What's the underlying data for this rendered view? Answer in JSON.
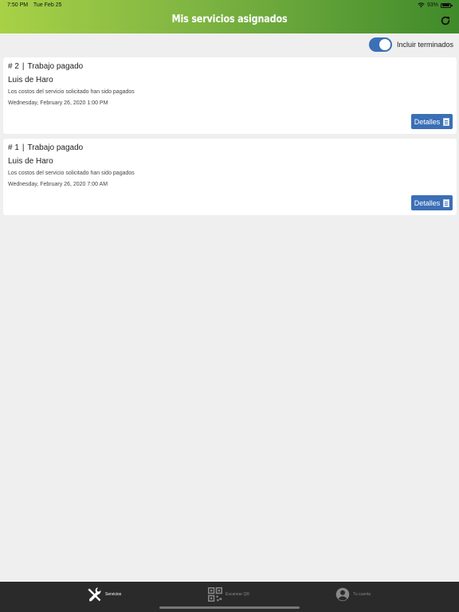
{
  "status_bar": {
    "time": "7:50 PM",
    "date": "Tue Feb 25",
    "battery": "93%",
    "battery_level": 0.93
  },
  "header": {
    "title": "Mis servicios asignados",
    "refresh_icon": "refresh-icon",
    "gradient_colors": [
      "#a8d146",
      "#3f8a2a"
    ]
  },
  "filter": {
    "label": "Incluir terminados",
    "enabled": true,
    "accent": "#3b6fb6"
  },
  "services": [
    {
      "number": "# 2",
      "status": "Trabajo pagado",
      "client": "Luis de Haro",
      "description": "Los costos del servicio solicitado han sido pagados",
      "date": "Wednesday, February 26, 2020 1:00 PM",
      "details_label": "Detalles"
    },
    {
      "number": "# 1",
      "status": "Trabajo pagado",
      "client": "Luis de Haro",
      "description": "Los costos del servicio solicitado han sido pagados",
      "date": "Wednesday, February 26, 2020 7:00 AM",
      "details_label": "Detalles"
    }
  ],
  "tabbar": {
    "tabs": [
      {
        "label": "Servicios",
        "icon": "tools-icon",
        "active": true
      },
      {
        "label": "Escanear QR",
        "icon": "qr-code-icon",
        "active": false
      },
      {
        "label": "Tu cuenta",
        "icon": "user-icon",
        "active": false
      }
    ]
  }
}
